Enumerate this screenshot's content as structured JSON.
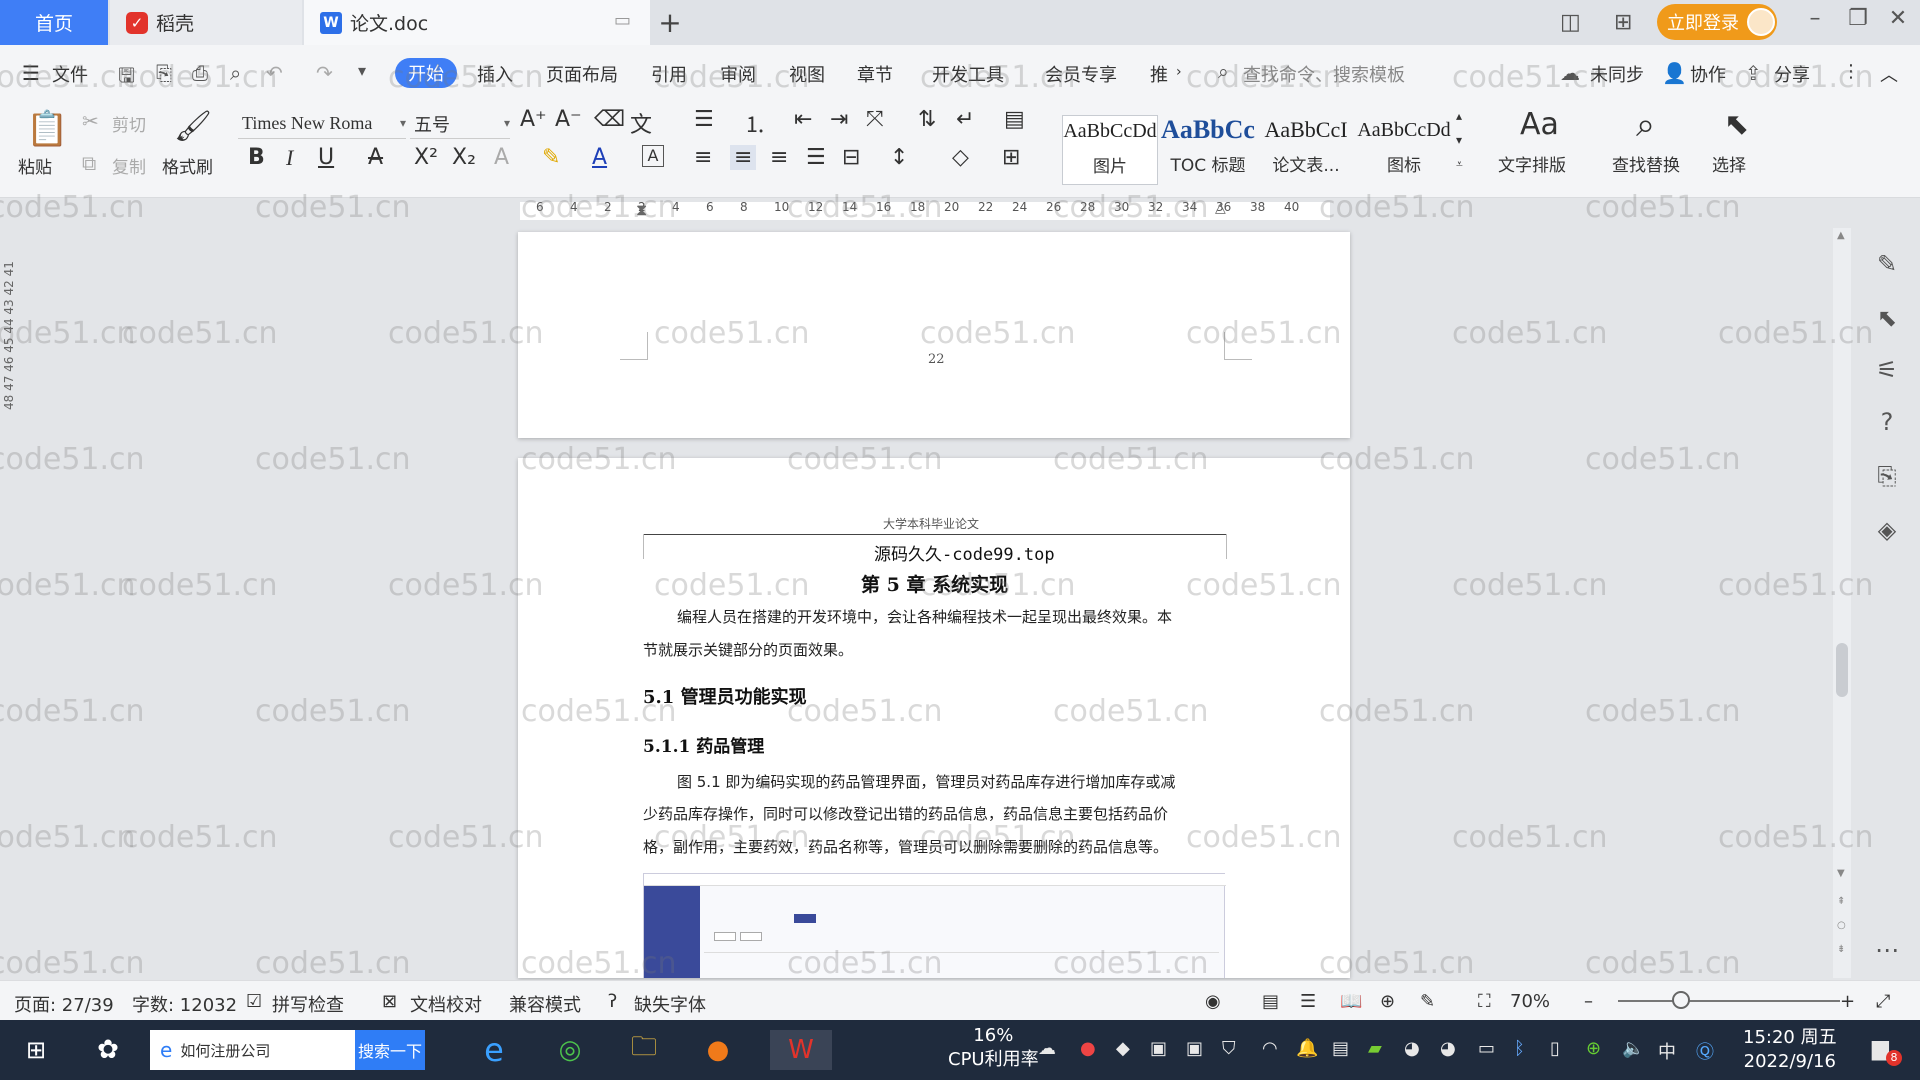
{
  "tabs": {
    "home": "首页",
    "daoke": "稻壳",
    "doc": "论文.doc",
    "login": "立即登录"
  },
  "menu": {
    "file": "文件",
    "start": "开始",
    "insert": "插入",
    "layout": "页面布局",
    "references": "引用",
    "review": "审阅",
    "view": "视图",
    "chapter": "章节",
    "devtools": "开发工具",
    "member": "会员专享",
    "more": "推",
    "search_cmd": "查找命令、搜索模板",
    "sync": "未同步",
    "collab": "协作",
    "share": "分享"
  },
  "ribbon": {
    "paste": "粘贴",
    "cut": "剪切",
    "copy": "复制",
    "format_painter": "格式刷",
    "font_name": "Times New Roma",
    "font_size": "五号",
    "styles": [
      {
        "sample": "AaBbCcDd",
        "name": "图片"
      },
      {
        "sample": "AaBbCc",
        "name": "TOC 标题"
      },
      {
        "sample": "AaBbCcI",
        "name": "论文表..."
      },
      {
        "sample": "AaBbCcDd",
        "name": "图标"
      }
    ],
    "text_layout": "文字排版",
    "find_replace": "查找替换",
    "select": "选择"
  },
  "ruler_ticks": [
    "6",
    "4",
    "2",
    "2",
    "4",
    "6",
    "8",
    "10",
    "12",
    "14",
    "16",
    "18",
    "20",
    "22",
    "24",
    "26",
    "28",
    "30",
    "32",
    "34",
    "36",
    "38",
    "40"
  ],
  "vruler": "48 47 46 45 44 43 42 41",
  "document": {
    "page_number": "22",
    "header": "大学本科毕业论文",
    "source": "源码久久-code99.top",
    "chapter_title": "第 5 章  系统实现",
    "para1_line1": "编程人员在搭建的开发环境中，会让各种编程技术一起呈现出最终效果。本",
    "para1_line2": "节就展示关键部分的页面效果。",
    "h2": "5.1  管理员功能实现",
    "h3": "5.1.1  药品管理",
    "para2_line1": "图 5.1  即为编码实现的药品管理界面，管理员对药品库存进行增加库存或减",
    "para2_line2": "少药品库存操作，同时可以修改登记出错的药品信息，药品信息主要包括药品价",
    "para2_line3": "格，副作用，主要药效，药品名称等，管理员可以删除需要删除的药品信息等。"
  },
  "status": {
    "page": "页面: 27/39",
    "words": "字数: 12032",
    "spell": "拼写检查",
    "doc_check": "文档校对",
    "compat": "兼容模式",
    "missing_font": "缺失字体",
    "zoom": "70%"
  },
  "taskbar": {
    "search_text": "如何注册公司",
    "search_btn": "搜索一下",
    "cpu_pct": "16%",
    "cpu_label": "CPU利用率",
    "ime": "中",
    "time": "15:20 周五",
    "date": "2022/9/16",
    "notify_count": "8"
  },
  "watermark": "code51.cn",
  "colors": {
    "accent": "#3f7ef6",
    "login": "#f09a1a",
    "taskbar": "#1f2b3d"
  }
}
